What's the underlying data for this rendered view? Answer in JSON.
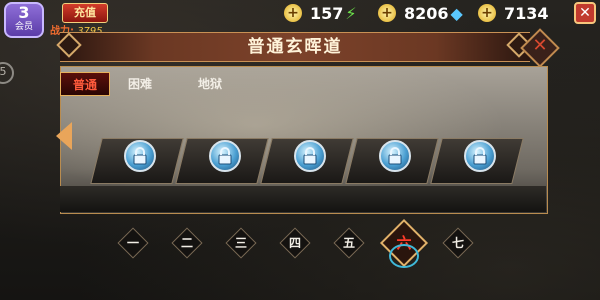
{
  "hud": {
    "vip_level": "3",
    "vip_text": "会员",
    "recharge_label": "充值",
    "power_label": "战力:",
    "power_value": "3795",
    "stamina": "157",
    "gold": "8206",
    "diamonds": "7134"
  },
  "panel": {
    "title": "普通玄晖道",
    "tabs": [
      {
        "label": "普通",
        "active": true
      },
      {
        "label": "困难",
        "active": false
      },
      {
        "label": "地狱",
        "active": false
      }
    ],
    "stages": [
      {
        "locked": true
      },
      {
        "locked": true
      },
      {
        "locked": true
      },
      {
        "locked": true
      },
      {
        "locked": true
      }
    ],
    "chapters": [
      {
        "label": "一",
        "active": false
      },
      {
        "label": "二",
        "active": false
      },
      {
        "label": "三",
        "active": false
      },
      {
        "label": "四",
        "active": false
      },
      {
        "label": "五",
        "active": false
      },
      {
        "label": "六",
        "active": true
      },
      {
        "label": "七",
        "active": false
      }
    ]
  },
  "colors": {
    "accent_red": "#ff3b2a",
    "gold_border": "#e1b26a",
    "lock_blue": "#4a9fd2"
  }
}
